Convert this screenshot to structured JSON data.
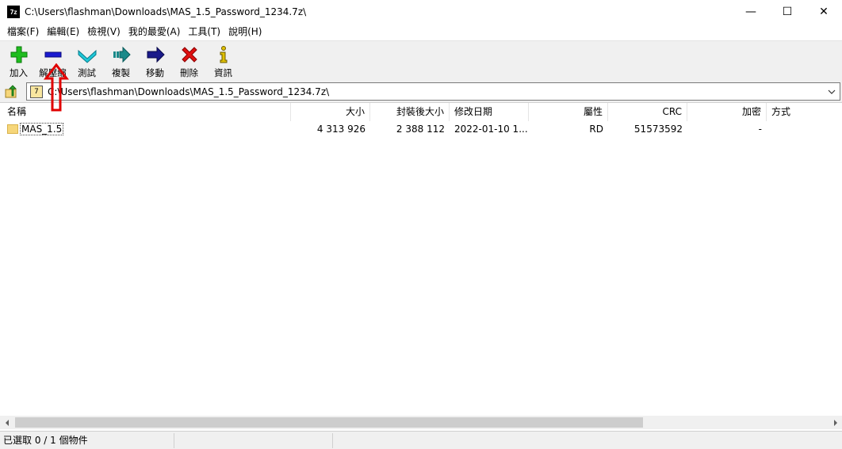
{
  "window": {
    "app_icon_text": "7z",
    "title": "C:\\Users\\flashman\\Downloads\\MAS_1.5_Password_1234.7z\\",
    "minimize": "—",
    "maximize": "☐",
    "close": "✕"
  },
  "menu": {
    "items": [
      "檔案(F)",
      "編輯(E)",
      "檢視(V)",
      "我的最愛(A)",
      "工具(T)",
      "說明(H)"
    ]
  },
  "toolbar": {
    "items": [
      {
        "label": "加入",
        "icon": "plus-icon",
        "color": "#1fbd1f"
      },
      {
        "label": "解壓縮",
        "icon": "minus-icon",
        "color": "#1a1ad0"
      },
      {
        "label": "測試",
        "icon": "check-chevron-icon",
        "color": "#1fc8d8"
      },
      {
        "label": "複製",
        "icon": "copy-arrow-icon",
        "color": "#1a8a8a"
      },
      {
        "label": "移動",
        "icon": "move-arrow-icon",
        "color": "#1a1a8a"
      },
      {
        "label": "刪除",
        "icon": "delete-x-icon",
        "color": "#e01010"
      },
      {
        "label": "資訊",
        "icon": "info-icon",
        "color": "#e0c000"
      }
    ]
  },
  "address": {
    "path": "C:\\Users\\flashman\\Downloads\\MAS_1.5_Password_1234.7z\\",
    "icon_text": "7"
  },
  "columns": [
    "名稱",
    "大小",
    "封裝後大小",
    "修改日期",
    "屬性",
    "CRC",
    "加密",
    "方式"
  ],
  "rows": [
    {
      "name": "MAS_1.5",
      "size": "4 313 926",
      "packed": "2 388 112",
      "modified": "2022-01-10 1...",
      "attributes": "RD",
      "crc": "51573592",
      "encrypted": "-",
      "method": ""
    }
  ],
  "status": {
    "selection": "已選取 0 / 1 個物件",
    "seg2": "",
    "seg3": ""
  },
  "colors": {
    "toolbar_bg": "#f0f0f0",
    "annotation_arrow": "#e00000"
  }
}
